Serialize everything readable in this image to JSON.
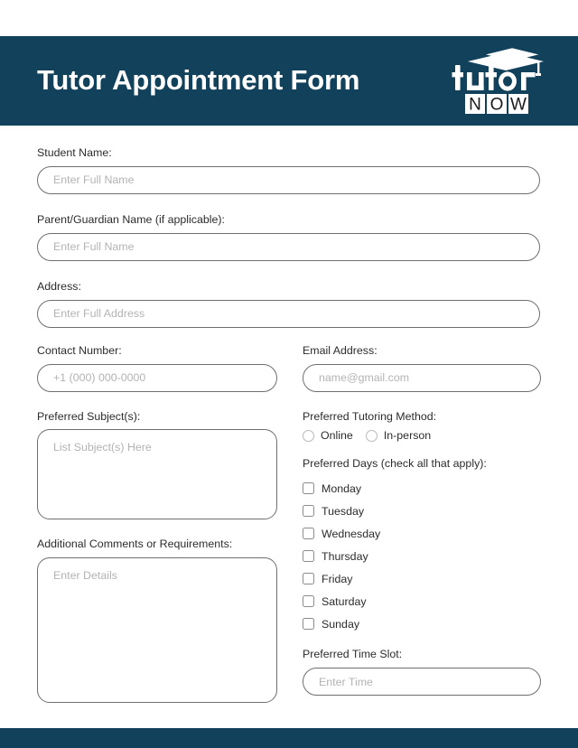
{
  "header": {
    "title": "Tutor Appointment Form",
    "brand": {
      "word_top": "tutor",
      "word_bottom": "NOW",
      "cap_icon": "graduation-cap-icon"
    },
    "background_color": "#12415c"
  },
  "form": {
    "student_name": {
      "label": "Student Name:",
      "placeholder": "Enter Full Name",
      "value": ""
    },
    "parent_name": {
      "label": "Parent/Guardian Name (if applicable):",
      "placeholder": "Enter Full Name",
      "value": ""
    },
    "address": {
      "label": "Address:",
      "placeholder": "Enter Full Address",
      "value": ""
    },
    "contact_number": {
      "label": "Contact Number:",
      "placeholder": "+1 (000) 000-0000",
      "value": ""
    },
    "email": {
      "label": "Email Address:",
      "placeholder": "name@gmail.com",
      "value": ""
    },
    "subjects": {
      "label": "Preferred Subject(s):",
      "placeholder": "List Subject(s) Here",
      "value": ""
    },
    "tutoring_method": {
      "label": "Preferred Tutoring Method:",
      "options": [
        {
          "label": "Online",
          "selected": false
        },
        {
          "label": "In-person",
          "selected": false
        }
      ]
    },
    "preferred_days": {
      "label": "Preferred Days (check all that apply):",
      "options": [
        {
          "label": "Monday",
          "checked": false
        },
        {
          "label": "Tuesday",
          "checked": false
        },
        {
          "label": "Wednesday",
          "checked": false
        },
        {
          "label": "Thursday",
          "checked": false
        },
        {
          "label": "Friday",
          "checked": false
        },
        {
          "label": "Saturday",
          "checked": false
        },
        {
          "label": "Sunday",
          "checked": false
        }
      ]
    },
    "time_slot": {
      "label": "Preferred Time Slot:",
      "placeholder": "Enter Time",
      "value": ""
    },
    "comments": {
      "label": "Additional Comments or Requirements:",
      "placeholder": "Enter Details",
      "value": ""
    }
  },
  "footer": {
    "background_color": "#12415c"
  }
}
